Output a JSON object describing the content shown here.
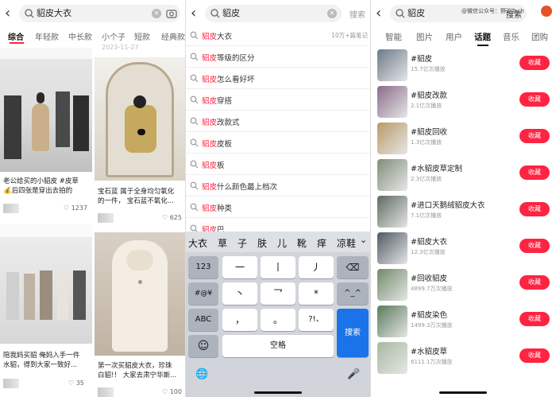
{
  "panel1": {
    "query": "貂皮大衣",
    "tabs": [
      "综合",
      "年轻款",
      "中长款",
      "小个子",
      "短款",
      "经典款"
    ],
    "cards": [
      {
        "title_line1": "老公给买的小貂皮 #皮草",
        "title_line2": "💰后四张是穿出去拍的",
        "likes": "1237"
      },
      {
        "date": "2023-11-27",
        "title_line1": "宝石蓝 属于全身均匀氧化",
        "title_line2": "的一件，  宝石蓝不氧化...",
        "likes": "625"
      },
      {
        "title_line1": "陪我妈买貂 俺妈入手一件",
        "title_line2": "水貂，得到大家一致好...",
        "likes": "35"
      },
      {
        "title_line1": "第一次买貂皮大衣，珍珠",
        "title_line2": "白貂!！ 大家去肃宁华斯...",
        "likes": "100"
      }
    ]
  },
  "panel2": {
    "query": "貂皮",
    "search_label": "搜索",
    "highlight": "貂皮",
    "suggestions": [
      {
        "pre": "",
        "hl": "貂皮",
        "post": "大衣",
        "count": "10万+篇笔记"
      },
      {
        "pre": "",
        "hl": "貂皮",
        "post": "等级的区分",
        "count": ""
      },
      {
        "pre": "",
        "hl": "貂皮",
        "post": "怎么看好坏",
        "count": ""
      },
      {
        "pre": "",
        "hl": "貂皮",
        "post": "穿搭",
        "count": ""
      },
      {
        "pre": "",
        "hl": "貂皮",
        "post": "改款式",
        "count": ""
      },
      {
        "pre": "",
        "hl": "貂皮",
        "post": "皮板",
        "count": ""
      },
      {
        "pre": "",
        "hl": "貂皮",
        "post": "板",
        "count": ""
      },
      {
        "pre": "",
        "hl": "貂皮",
        "post": "什么颜色最上档次",
        "count": ""
      },
      {
        "pre": "",
        "hl": "貂皮",
        "post": "种类",
        "count": ""
      },
      {
        "pre": "",
        "hl": "貂皮",
        "post": "巴",
        "count": ""
      }
    ],
    "candidates": [
      "大衣",
      "草",
      "子",
      "肤",
      "儿",
      "靴",
      "痒",
      "凉鞋"
    ],
    "keys": {
      "k123": "123",
      "k1": "一",
      "k2": "丨",
      "k3": "丿",
      "del": "⌫",
      "ksym": "#@¥",
      "k4": "丶",
      "k5": "乛",
      "k6": "*",
      "kface": "^_^",
      "kabc": "ABC",
      "k7": "，",
      "k8": "。",
      "k9": "?!、",
      "search": "搜索",
      "emoji": "☺",
      "space": "空格",
      "globe": "🌐",
      "mic": "🎤"
    }
  },
  "panel3": {
    "query": "貂皮",
    "search_label": "搜索",
    "watermark": "@微信公众号：野驴Tech",
    "tabs": [
      "智能",
      "图片",
      "用户",
      "话题",
      "音乐",
      "团购"
    ],
    "active_tab": 3,
    "follow_label": "收藏",
    "topics": [
      {
        "name": "#貂皮",
        "count": "15.7亿次播放",
        "color": "#6b7a88"
      },
      {
        "name": "#貂皮改款",
        "count": "2.1亿次播放",
        "color": "#8a6b8a"
      },
      {
        "name": "#貂皮回收",
        "count": "1.3亿次播放",
        "color": "#b89a6a"
      },
      {
        "name": "#水貂皮草定制",
        "count": "2.3亿次播放",
        "color": "#7f8d7a"
      },
      {
        "name": "#进口天鹅绒貂皮大衣",
        "count": "7.1亿次播放",
        "color": "#5f6a60"
      },
      {
        "name": "#貂皮大衣",
        "count": "12.3亿次播放",
        "color": "#4f5963"
      },
      {
        "name": "#回收貂皮",
        "count": "4899.7万次播放",
        "color": "#6f8a6a"
      },
      {
        "name": "#貂皮染色",
        "count": "1499.3万次播放",
        "color": "#5a7a5a"
      },
      {
        "name": "#水貂皮草",
        "count": "6111.1万次播放",
        "color": "#a8b8a0"
      }
    ]
  }
}
